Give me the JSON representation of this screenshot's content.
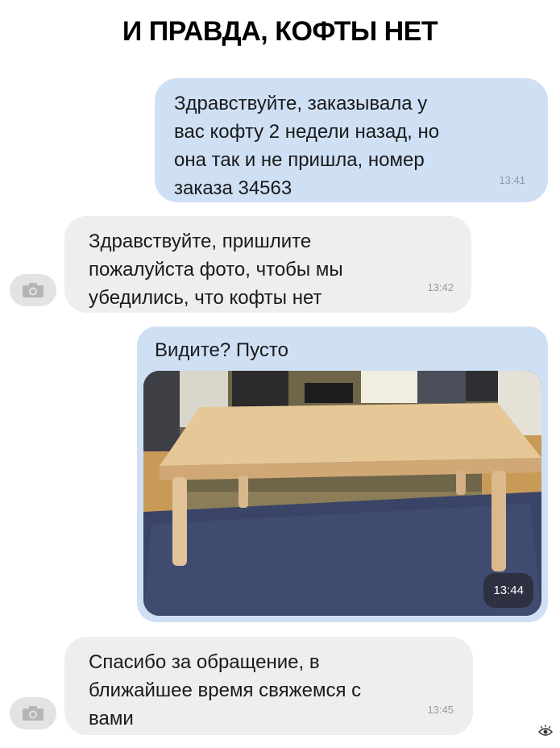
{
  "title": "И ПРАВДА, КОФТЫ НЕТ",
  "messages": [
    {
      "lines": [
        "Здравствуйте, заказывала у",
        "вас кофту 2 недели назад, но",
        "она так и не пришла, номер",
        "заказа 34563"
      ],
      "time": "13:41"
    },
    {
      "lines": [
        "Здравствуйте, пришлите",
        "пожалуйста фото, чтобы мы",
        "убедились, что кофты нет"
      ],
      "time": "13:42"
    },
    {
      "text": "Видите? Пусто",
      "time": "13:44"
    },
    {
      "lines": [
        "Спасибо за обращение, в",
        "ближайшее время свяжемся с",
        "вами"
      ],
      "time": "13:45"
    }
  ],
  "icons": {
    "avatar": "camera-icon",
    "watermark": "eye-logo-icon"
  },
  "colors": {
    "outgoing_bubble": "#cfe0f5",
    "incoming_bubble": "#eeeeee",
    "rug": "#3a4466",
    "table_wood": "#e6c898"
  }
}
